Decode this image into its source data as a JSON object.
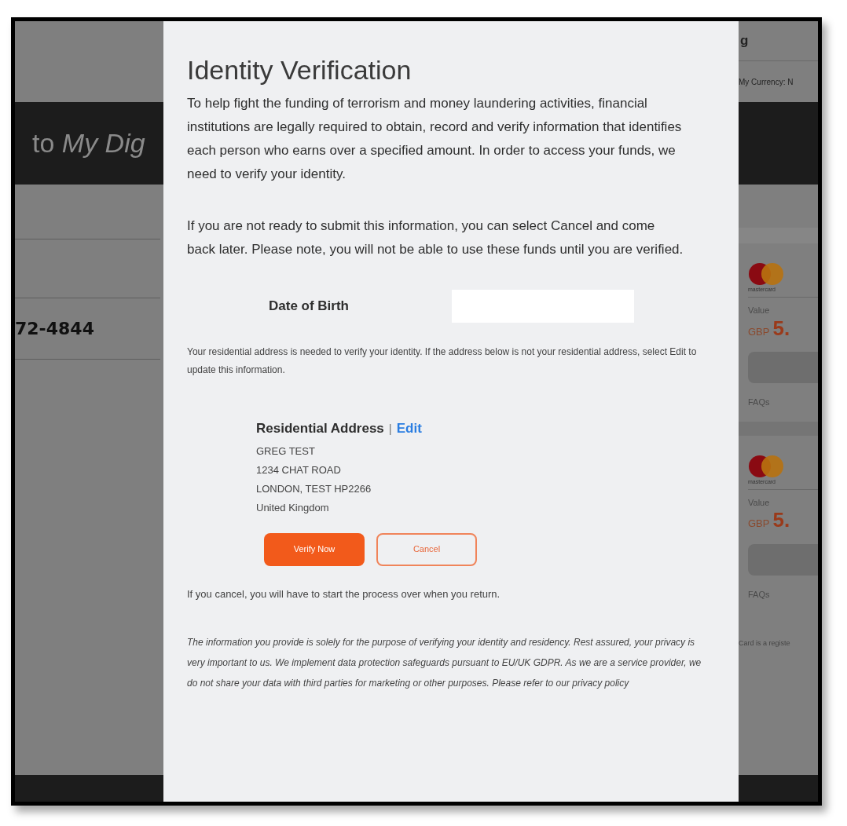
{
  "background": {
    "left": {
      "banner": "to *My Dig*",
      "account_number": "72-4844"
    },
    "right": {
      "header": "g",
      "currency": "My Currency: N",
      "cards": [
        {
          "brand": "mastercard",
          "value_label": "Value",
          "currency": "GBP",
          "amount": "5.",
          "link": "FAQs"
        },
        {
          "brand": "mastercard",
          "value_label": "Value",
          "currency": "GBP",
          "amount": "5.",
          "link": "FAQs"
        }
      ],
      "footer_note": "Card is a registe"
    }
  },
  "dialog": {
    "title": "Identity Verification",
    "paragraphs": [
      "To help fight the funding of terrorism and money laundering activities, financial institutions are legally required to obtain, record and verify information that identifies each person who earns over a specified amount. In order to access your funds, we need to verify your identity.",
      "If you are not ready to submit this information, you can select Cancel and come back later. Please note, you will not be able to use these funds until you are verified."
    ],
    "dob": {
      "label": "Date of Birth"
    },
    "address_note": "Your residential address is needed to verify your identity. If the address below is not your residential address, select Edit to update this information.",
    "address": {
      "title": "Residential Address",
      "separator": "|",
      "edit": "Edit",
      "lines": [
        "GREG TEST",
        "1234 CHAT ROAD",
        "LONDON, TEST HP2266",
        "United Kingdom"
      ]
    },
    "buttons": [
      {
        "label": "Verify Now",
        "kind": "primary"
      },
      {
        "label": "Cancel",
        "kind": "secondary"
      }
    ],
    "cancel_note": "If you cancel, you will have to start the process over when you return.",
    "privacy": "The information you provide is solely for the purpose of verifying your identity and residency. Rest assured, your privacy is very important to us. We implement data protection safeguards pursuant to EU/UK GDPR. As we are a service provider, we do not share your data with third parties for marketing or other purposes. Please refer to our privacy policy"
  }
}
